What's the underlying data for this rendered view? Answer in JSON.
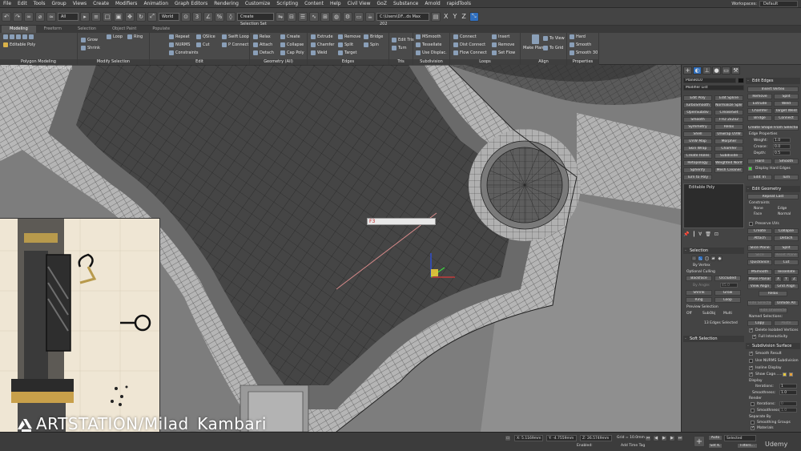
{
  "menu": [
    "File",
    "Edit",
    "Tools",
    "Group",
    "Views",
    "Create",
    "Modifiers",
    "Animation",
    "Graph Editors",
    "Rendering",
    "Customize",
    "Scripting",
    "Content",
    "Help",
    "Civil View",
    "GoZ",
    "Substance",
    "Arnold",
    "rapidTools"
  ],
  "workspace": {
    "label": "Workspaces:",
    "value": "Default"
  },
  "toolbar": {
    "filter": "All",
    "view": "World",
    "selection_set": "Create Selection Set",
    "path": "C:\\Users\\DF...ds Max 202",
    "axes": [
      "X",
      "Y",
      "Z"
    ]
  },
  "ribbon_tabs": [
    "Modeling",
    "Freeform",
    "Selection",
    "Object Paint",
    "Populate"
  ],
  "ribbon": {
    "groups": [
      "Polygon Modeling",
      "Modify Selection",
      "Edit",
      "Geometry (All)",
      "Edges",
      "Tris",
      "Subdivision",
      "Loops",
      "Align",
      "Properties"
    ],
    "poly_modeling": [
      "Editable Poly"
    ],
    "modify": [
      "Grow",
      "Shrink",
      "Loop",
      "Ring"
    ],
    "edit": [
      "Repeat",
      "QSlice",
      "Swift Loop",
      "NURMS",
      "Cut",
      "P Connect",
      "Constraints"
    ],
    "geometry": [
      "Relax",
      "Create",
      "Attach",
      "Collapse",
      "Detach",
      "Cap Poly"
    ],
    "edges": [
      "Extrude",
      "Remove",
      "Bridge",
      "Chamfer",
      "Split",
      "Spin",
      "Weld",
      "Target"
    ],
    "tris": [
      "Edit Tris",
      "Turn"
    ],
    "subdivision": [
      "MSmooth",
      "Tessellate",
      "Use Displac."
    ],
    "loops": [
      "Connect",
      "Insert",
      "Dist Connect",
      "Remove",
      "Flow Connect",
      "Set Flow"
    ],
    "align": [
      "Make Planar",
      "To View",
      "To Grid"
    ],
    "properties": [
      "Hard",
      "Smooth",
      "Smooth 30"
    ]
  },
  "viewport": {
    "label": "[+] [Perspective] [Default Shading]",
    "input_text": "F3"
  },
  "reference_watermark": "ARTSTATION/Milad_Kambari",
  "command_panel": {
    "object_name": "Plane010",
    "modifier_list": "Modifier List",
    "modifier_buttons": [
      "Edit Poly",
      "Edit Spline",
      "TurboSmooth",
      "Normalize Spline",
      "OpenSubdiv",
      "CreaseSet",
      "Smooth",
      "FFD 2x2x2",
      "Symmetry",
      "Relax",
      "Shell",
      "Unwrap UVW",
      "UVW Map",
      "Morpher",
      "Skin Wrap",
      "Chamfer",
      "Create Holes",
      "Subdivide",
      "Retopology",
      "Weighted Normals",
      "Spherify",
      "Mesh Cleaner",
      "Turn to Poly"
    ],
    "stack_item": "Editable Poly",
    "edit_edges": {
      "title": "Edit Edges",
      "insert_vertex": "Insert Vertex",
      "buttons": [
        "Remove",
        "Split",
        "Extrude",
        "Weld",
        "Chamfer",
        "Target Weld",
        "Bridge",
        "Connect"
      ],
      "create_shape": "Create Shape From Selection",
      "edge_properties": "Edge Properties",
      "weight_label": "Weight:",
      "weight": "1.0",
      "crease_label": "Crease:",
      "crease": "0.0",
      "depth_label": "Depth:",
      "depth": "0.5",
      "hard": "Hard",
      "smooth": "Smooth",
      "display_hard": "Display Hard Edges",
      "edit_tri": "Edit Tri",
      "turn": "Turn"
    },
    "edit_geometry": {
      "title": "Edit Geometry",
      "repeat_last": "Repeat Last",
      "constraints": "Constraints",
      "c_none": "None",
      "c_edge": "Edge",
      "c_face": "Face",
      "c_normal": "Normal",
      "preserve_uvs": "Preserve UVs",
      "create": "Create",
      "collapse": "Collapse",
      "attach": "Attach",
      "detach": "Detach",
      "slice_plane": "Slice Plane",
      "split": "Split",
      "slice": "Slice",
      "reset_plane": "Reset Plane",
      "quickslice": "QuickSlice",
      "cut": "Cut",
      "msmooth": "MSmooth",
      "tessellate": "Tessellate",
      "make_planar": "Make Planar",
      "x": "X",
      "y": "Y",
      "z": "Z",
      "view_align": "View Align",
      "grid_align": "Grid Align",
      "relax": "Relax",
      "hide_selected": "Hide Selected",
      "unhide_all": "Unhide All",
      "hide_unselected": "Hide Unselected",
      "named_selections": "Named Selections:",
      "copy": "Copy",
      "paste": "Paste",
      "delete_isolated": "Delete Isolated Vertices",
      "full_interactivity": "Full Interactivity"
    },
    "selection": {
      "title": "Selection",
      "by_vertex": "By Vertex",
      "optional_culling": "Optional Culling",
      "by_angle": "By Angle:",
      "angle": "45.0",
      "shrink": "Shrink",
      "grow": "Grow",
      "ring": "Ring",
      "loop": "Loop",
      "backface": "Backface",
      "occluded": "Occluded",
      "preview_selection": "Preview Selection",
      "off": "Off",
      "subobj": "SubObj",
      "multi": "Multi",
      "status": "13 Edges Selected"
    },
    "soft_selection": "Soft Selection",
    "subdivision_surface": {
      "title": "Subdivision Surface",
      "smooth_result": "Smooth Result",
      "use_nurms": "Use NURMS Subdivision",
      "isoline": "Isoline Display",
      "show_cage": "Show Cage......",
      "display": "Display",
      "iterations_label": "Iterations:",
      "iterations": "1",
      "smoothness_label": "Smoothness:",
      "smoothness": "1.0",
      "render": "Render",
      "r_iterations": "0",
      "r_smoothness": "1.0",
      "separate_by": "Separate By",
      "smoothing_groups": "Smoothing Groups",
      "materials": "Materials"
    }
  },
  "status": {
    "x": "X: 5.1169mm",
    "y": "Y: -4.7559mm",
    "z": "Z: 26.5749mm",
    "grid": "Grid = 10.0mm",
    "add_time_tag": "Add Time Tag",
    "enabled": "Enabled:",
    "auto": "Auto",
    "setk": "Set K.",
    "selected": "Selected",
    "filters": "Filters...",
    "brand": "Udemy"
  },
  "colors": {
    "accent": "#2f6fbf",
    "viewport_bg": "#7a7a7a",
    "mesh_dark": "#464646",
    "wire": "#1c1c1c",
    "selected_edge": "#d98a8a"
  }
}
